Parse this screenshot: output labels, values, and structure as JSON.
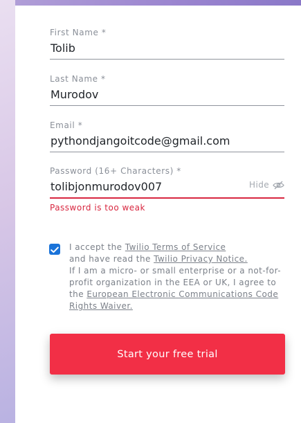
{
  "form": {
    "first_name": {
      "label": "First Name *",
      "value": "Tolib"
    },
    "last_name": {
      "label": "Last Name *",
      "value": "Murodov"
    },
    "email": {
      "label": "Email *",
      "value": "pythondjangoitcode@gmail.com"
    },
    "password": {
      "label": "Password (16+ Characters) *",
      "value": "tolibjonmurodov007",
      "toggle_label": "Hide",
      "toggle_icon": "eye-slash-icon",
      "error": "Password is too weak"
    },
    "consent": {
      "checked": true,
      "text_1": "I accept the ",
      "link_terms": "Twilio Terms of Service",
      "text_2": "and have read the ",
      "link_privacy": "Twilio Privacy Notice.",
      "text_3": "If I am a micro- or small enterprise or a not-for-profit organization in the EEA or UK, I agree to the ",
      "link_eecc": "European Electronic Communications Code Rights Waiver."
    },
    "submit_label": "Start your free trial"
  },
  "colors": {
    "accent": "#f22f46",
    "error": "#d8263f",
    "checkbox": "#1a73d9"
  }
}
